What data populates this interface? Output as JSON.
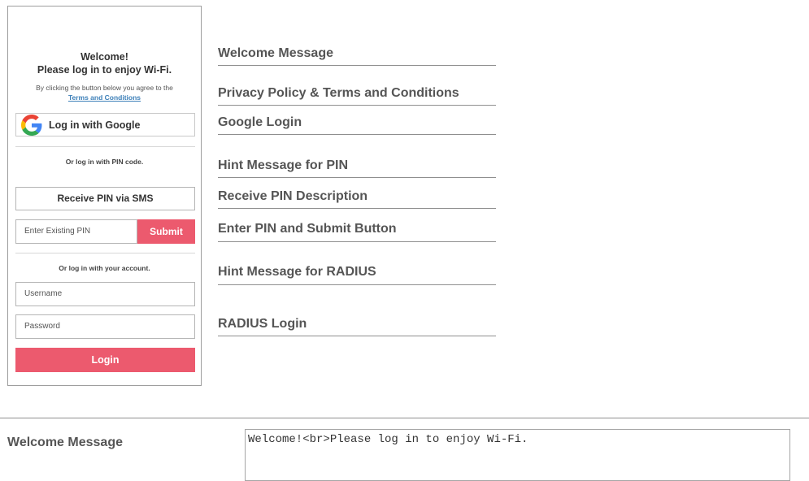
{
  "preview": {
    "welcome_line1": "Welcome!",
    "welcome_line2": "Please log in to enjoy Wi-Fi.",
    "agree_text": "By clicking the button below you agree to the",
    "terms_link": "Terms and Conditions",
    "google_button_label": "Log in with Google",
    "pin_hint": "Or log in with PIN code.",
    "receive_pin_button": "Receive PIN via SMS",
    "pin_placeholder": "Enter Existing PIN",
    "submit_button": "Submit",
    "radius_hint": "Or log in with your account.",
    "username_placeholder": "Username",
    "password_placeholder": "Password",
    "login_button": "Login",
    "accent_color": "#ec5a6e"
  },
  "callouts": [
    "Welcome Message",
    "Privacy Policy & Terms and Conditions",
    "Google Login",
    "Hint Message for PIN",
    "Receive PIN Description",
    "Enter PIN and Submit Button",
    "Hint Message for RADIUS",
    "RADIUS Login"
  ],
  "form": {
    "welcome_label": "Welcome Message",
    "welcome_value": "Welcome!<br>Please log in to enjoy Wi-Fi."
  }
}
